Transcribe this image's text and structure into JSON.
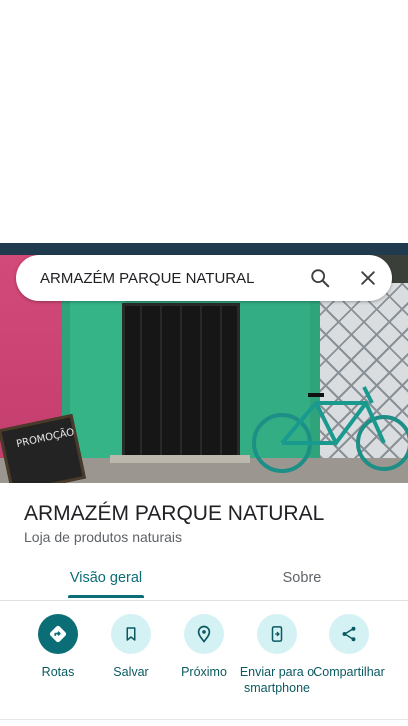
{
  "search": {
    "query": "ARMAZÉM PARQUE NATURAL"
  },
  "photo": {
    "sign_text": "PROMOÇÃO"
  },
  "place": {
    "name": "ARMAZÉM PARQUE NATURAL",
    "category": "Loja de produtos naturais"
  },
  "tabs": [
    {
      "label": "Visão geral",
      "active": true
    },
    {
      "label": "Sobre",
      "active": false
    }
  ],
  "actions": [
    {
      "label": "Rotas",
      "icon": "directions-icon"
    },
    {
      "label": "Salvar",
      "icon": "bookmark-icon"
    },
    {
      "label": "Próximo",
      "icon": "nearby-icon"
    },
    {
      "label": "Enviar para o smartphone",
      "icon": "send-to-phone-icon"
    },
    {
      "label": "Compartilhar",
      "icon": "share-icon"
    }
  ],
  "colors": {
    "accent": "#0b6e76",
    "action_bg": "#d4f1f4"
  }
}
